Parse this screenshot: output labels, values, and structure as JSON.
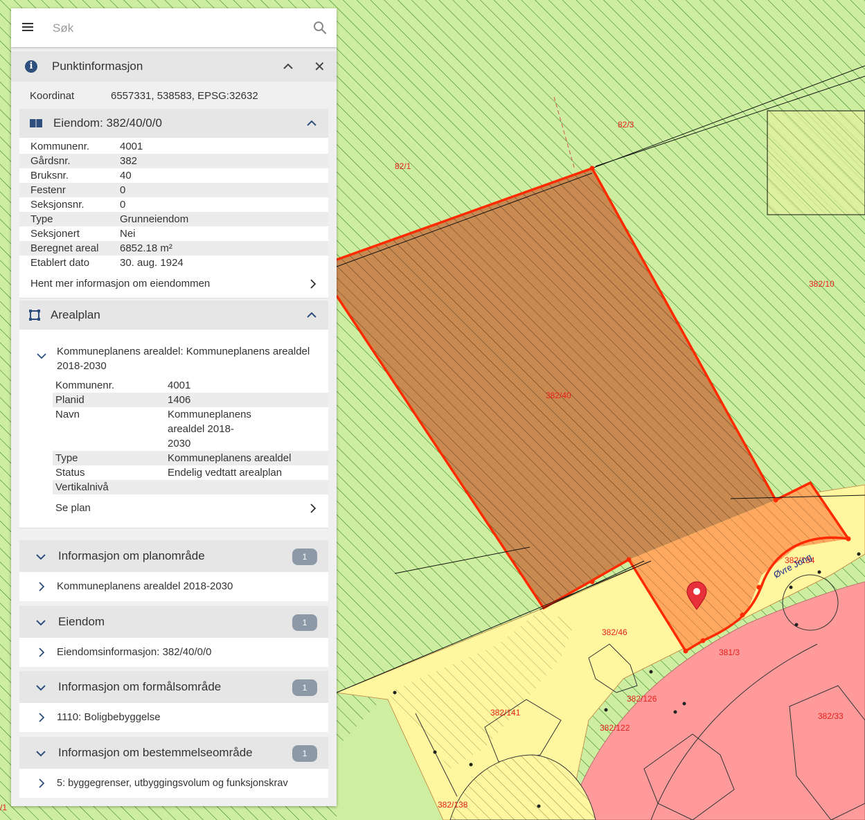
{
  "search": {
    "placeholder": "Søk"
  },
  "point_info": {
    "title": "Punktinformasjon",
    "coord_label": "Koordinat",
    "coord_value": "6557331, 538583, EPSG:32632"
  },
  "property": {
    "title": "Eiendom: 382/40/0/0",
    "rows": [
      {
        "k": "Kommunenr.",
        "v": "4001"
      },
      {
        "k": "Gårdsnr.",
        "v": "382"
      },
      {
        "k": "Bruksnr.",
        "v": "40"
      },
      {
        "k": "Festenr",
        "v": "0"
      },
      {
        "k": "Seksjonsnr.",
        "v": "0"
      },
      {
        "k": "Type",
        "v": "Grunneiendom"
      },
      {
        "k": "Seksjonert",
        "v": "Nei"
      },
      {
        "k": "Beregnet areal",
        "v": "6852.18 m²"
      },
      {
        "k": "Etablert dato",
        "v": "30. aug. 1924"
      }
    ],
    "more_link": "Hent mer informasjon om eiendommen"
  },
  "arealplan": {
    "title": "Arealplan",
    "plan_title_line1": "Kommuneplanens arealdel: Kommuneplanens arealdel",
    "plan_title_line2": "2018-2030",
    "rows": [
      {
        "k": "Kommunenr.",
        "v": "4001"
      },
      {
        "k": "Planid",
        "v": "1406"
      },
      {
        "k": "Navn",
        "v1": "Kommuneplanens",
        "v2": "arealdel 2018-",
        "v3": "2030"
      },
      {
        "k": "Type",
        "v": "Kommuneplanens arealdel"
      },
      {
        "k": "Status",
        "v": "Endelig vedtatt arealplan"
      },
      {
        "k": "Vertikalnivå",
        "v": ""
      }
    ],
    "see_plan": "Se plan"
  },
  "sections": [
    {
      "title": "Informasjon om planområde",
      "count": "1",
      "item": "Kommuneplanens arealdel 2018-2030"
    },
    {
      "title": "Eiendom",
      "count": "1",
      "item": "Eiendomsinformasjon: 382/40/0/0"
    },
    {
      "title": "Informasjon om formålsområde",
      "count": "1",
      "item": "1110: Boligbebyggelse"
    },
    {
      "title": "Informasjon om bestemmelseområde",
      "count": "1",
      "item": "5: byggegrenser, utbyggingsvolum og funksjonskrav"
    }
  ],
  "map": {
    "labels": [
      "82/3",
      "82/1",
      "382/10",
      "382/40",
      "382/46",
      "381/3",
      "382/126",
      "382/141",
      "382/122",
      "382/33",
      "382/138",
      "Øvre Jong",
      "382/134",
      "/1"
    ],
    "colors": {
      "green": "#cfeea0",
      "yellow": "#fffaa0",
      "red": "#ff9a9a",
      "selected": "#ff3000",
      "orange": "#ffa860",
      "brown": "#c88a50",
      "label": "#e8201c"
    }
  }
}
